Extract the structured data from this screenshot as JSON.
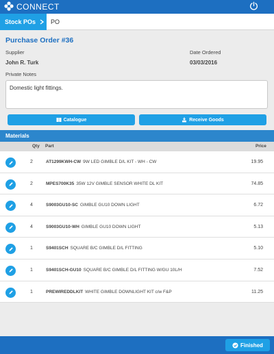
{
  "app": {
    "brand": "CONNECT"
  },
  "breadcrumb": {
    "active": "Stock POs",
    "current": "PO"
  },
  "order": {
    "title": "Purchase Order #36",
    "supplier_label": "Supplier",
    "supplier": "John R. Turk",
    "date_label": "Date Ordered",
    "date": "03/03/2016",
    "notes_label": "Private Notes",
    "notes": "Domestic light fittings."
  },
  "buttons": {
    "catalogue": "Catalogue",
    "receive": "Receive Goods",
    "finished": "Finished"
  },
  "materials": {
    "title": "Materials",
    "columns": {
      "qty": "Qty",
      "part": "Part",
      "price": "Price"
    },
    "rows": [
      {
        "qty": "2",
        "code": "AT1299KWH-CW",
        "desc": "9W LED GIMBLE D/L KIT - WH - CW",
        "price": "19.95"
      },
      {
        "qty": "2",
        "code": "MPES700K35",
        "desc": "35W 12V GIMBLE SENSOR WHITE DL KIT",
        "price": "74.85"
      },
      {
        "qty": "4",
        "code": "S9003GU10-SC",
        "desc": "GIMBLE GU10 DOWN LIGHT",
        "price": "6.72"
      },
      {
        "qty": "4",
        "code": "S9003GU10-WH",
        "desc": "GIMBLE GU10 DOWN LIGHT",
        "price": "5.13"
      },
      {
        "qty": "1",
        "code": "S9401SCH",
        "desc": "SQUARE B/C GIMBLE D/L FITTING",
        "price": "5.10"
      },
      {
        "qty": "1",
        "code": "S9401SCH-GU10",
        "desc": "SQUARE B/C GIMBLE D/L FITTING W/GU 10L/H",
        "price": "7.52"
      },
      {
        "qty": "1",
        "code": "PREWIREDDLKIT",
        "desc": "WHITE GIMBLE DOWNLIGHT KIT c/w F&P",
        "price": "11.25"
      }
    ]
  },
  "colors": {
    "primary": "#1d6fc1",
    "accent": "#1fa0e5",
    "section": "#2c86cc"
  },
  "icons": {
    "logo": "connect-logo-icon",
    "power": "power-icon",
    "edit": "pencil-icon",
    "check": "check-circle-icon"
  }
}
